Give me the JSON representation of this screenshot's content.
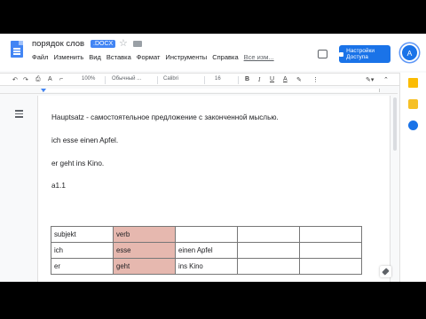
{
  "title_bar": {
    "doc_title": "порядок слов",
    "format_badge": ".DOCX",
    "share_label": "Настройки Доступа",
    "avatar_initial": "A"
  },
  "menu": [
    "Файл",
    "Изменить",
    "Вид",
    "Вставка",
    "Формат",
    "Инструменты",
    "Справка",
    "Все изм..."
  ],
  "toolbar": {
    "zoom": "100%",
    "style": "Обычный ...",
    "font": "Calibri",
    "font_size": "16",
    "bold": "B",
    "italic": "I",
    "underline": "U",
    "text_color": "A"
  },
  "document": {
    "line1": "Hauptsatz - самостоятельное предложение с законченной мыслью.",
    "line2": "ich esse einen Apfel.",
    "line3": "er geht ins Kino.",
    "line4": "a1.1",
    "table": [
      [
        "subjekt",
        "verb",
        "",
        "",
        ""
      ],
      [
        "ich",
        "esse",
        "einen Apfel",
        "",
        ""
      ],
      [
        "er",
        "geht",
        "ins Kino",
        "",
        ""
      ]
    ]
  },
  "colors": {
    "accent": "#1a73e8",
    "doc_icon": "#4285f4",
    "highlight_cell": "#e6b8af"
  }
}
